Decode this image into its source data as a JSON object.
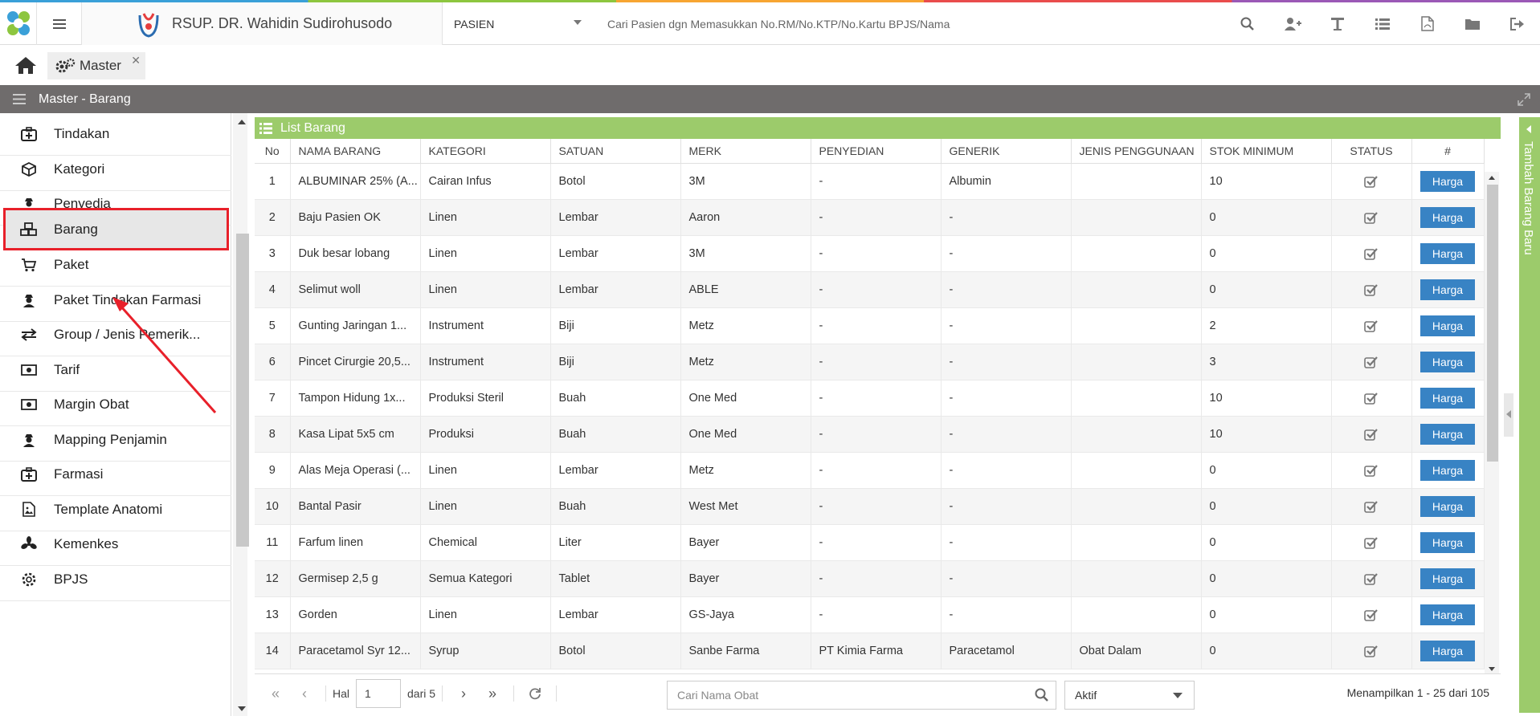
{
  "header": {
    "hospital_name": "RSUP. DR. Wahidin Sudirohusodo",
    "search_scope": "PASIEN",
    "search_placeholder": "Cari Pasien dgn Memasukkan No.RM/No.KTP/No.Kartu BPJS/Nama",
    "icons": [
      "search-icon",
      "add-user-icon",
      "text-icon",
      "list-icon",
      "pdf-icon",
      "folder-icon",
      "logout-icon"
    ]
  },
  "tabs": [
    {
      "label": "Master"
    }
  ],
  "title": "Master - Barang",
  "sidebar": {
    "items": [
      {
        "label": "Tindakan",
        "icon": "medkit-icon"
      },
      {
        "label": "Kategori",
        "icon": "cube-icon"
      },
      {
        "label": "Penyedia",
        "icon": "user-secret-icon"
      },
      {
        "label": "Barang",
        "icon": "cubes-icon",
        "active": true
      },
      {
        "label": "Paket",
        "icon": "cart-icon"
      },
      {
        "label": "Paket Tindakan Farmasi",
        "icon": "user-secret-icon"
      },
      {
        "label": "Group / Jenis Pemerik...",
        "icon": "exchange-icon"
      },
      {
        "label": "Tarif",
        "icon": "money-icon"
      },
      {
        "label": "Margin Obat",
        "icon": "money-icon"
      },
      {
        "label": "Mapping Penjamin",
        "icon": "user-secret-icon"
      },
      {
        "label": "Farmasi",
        "icon": "medkit-icon"
      },
      {
        "label": "Template Anatomi",
        "icon": "image-file-icon"
      },
      {
        "label": "Kemenkes",
        "icon": "fan-icon"
      },
      {
        "label": "BPJS",
        "icon": "gear-outline-icon"
      }
    ]
  },
  "panel": {
    "title": "List Barang",
    "side_button": "Tambah Barang Baru",
    "columns": [
      "No",
      "NAMA BARANG",
      "KATEGORI",
      "SATUAN",
      "MERK",
      "PENYEDIAN",
      "GENERIK",
      "JENIS PENGGUNAAN",
      "STOK MINIMUM",
      "STATUS",
      "#"
    ],
    "action_label": "Harga",
    "rows": [
      [
        "1",
        "ALBUMINAR 25% (A...",
        "Cairan Infus",
        "Botol",
        "3M",
        "-",
        "Albumin",
        "",
        "10"
      ],
      [
        "2",
        "Baju Pasien OK",
        "Linen",
        "Lembar",
        "Aaron",
        "-",
        "-",
        "",
        "0"
      ],
      [
        "3",
        "Duk besar lobang",
        "Linen",
        "Lembar",
        "3M",
        "-",
        "-",
        "",
        "0"
      ],
      [
        "4",
        "Selimut woll",
        "Linen",
        "Lembar",
        "ABLE",
        "-",
        "-",
        "",
        "0"
      ],
      [
        "5",
        "Gunting Jaringan 1...",
        "Instrument",
        "Biji",
        "Metz",
        "-",
        "-",
        "",
        "2"
      ],
      [
        "6",
        "Pincet Cirurgie 20,5...",
        "Instrument",
        "Biji",
        "Metz",
        "-",
        "-",
        "",
        "3"
      ],
      [
        "7",
        "Tampon Hidung 1x...",
        "Produksi Steril",
        "Buah",
        "One Med",
        "-",
        "-",
        "",
        "10"
      ],
      [
        "8",
        "Kasa Lipat 5x5 cm",
        "Produksi",
        "Buah",
        "One Med",
        "-",
        "-",
        "",
        "10"
      ],
      [
        "9",
        "Alas Meja Operasi (...",
        "Linen",
        "Lembar",
        "Metz",
        "-",
        "-",
        "",
        "0"
      ],
      [
        "10",
        "Bantal Pasir",
        "Linen",
        "Buah",
        "West Met",
        "-",
        "-",
        "",
        "0"
      ],
      [
        "11",
        "Farfum linen",
        "Chemical",
        "Liter",
        "Bayer",
        "-",
        "-",
        "",
        "0"
      ],
      [
        "12",
        "Germisep 2,5 g",
        "Semua Kategori",
        "Tablet",
        "Bayer",
        "-",
        "-",
        "",
        "0"
      ],
      [
        "13",
        "Gorden",
        "Linen",
        "Lembar",
        "GS-Jaya",
        "-",
        "-",
        "",
        "0"
      ],
      [
        "14",
        "Paracetamol Syr 12...",
        "Syrup",
        "Botol",
        "Sanbe Farma",
        "PT Kimia Farma",
        "Paracetamol",
        "Obat Dalam",
        "0"
      ]
    ]
  },
  "pager": {
    "hal_label": "Hal",
    "page": "1",
    "of_label": "dari 5",
    "search_placeholder": "Cari Nama Obat",
    "status_select": "Aktif",
    "info": "Menampilkan 1 - 25 dari 105"
  },
  "colors": {
    "accent_green": "#9ccb6b",
    "button_blue": "#3883c4",
    "titlebar_gray": "#6f6c6c",
    "highlight_red": "#e8202a"
  }
}
